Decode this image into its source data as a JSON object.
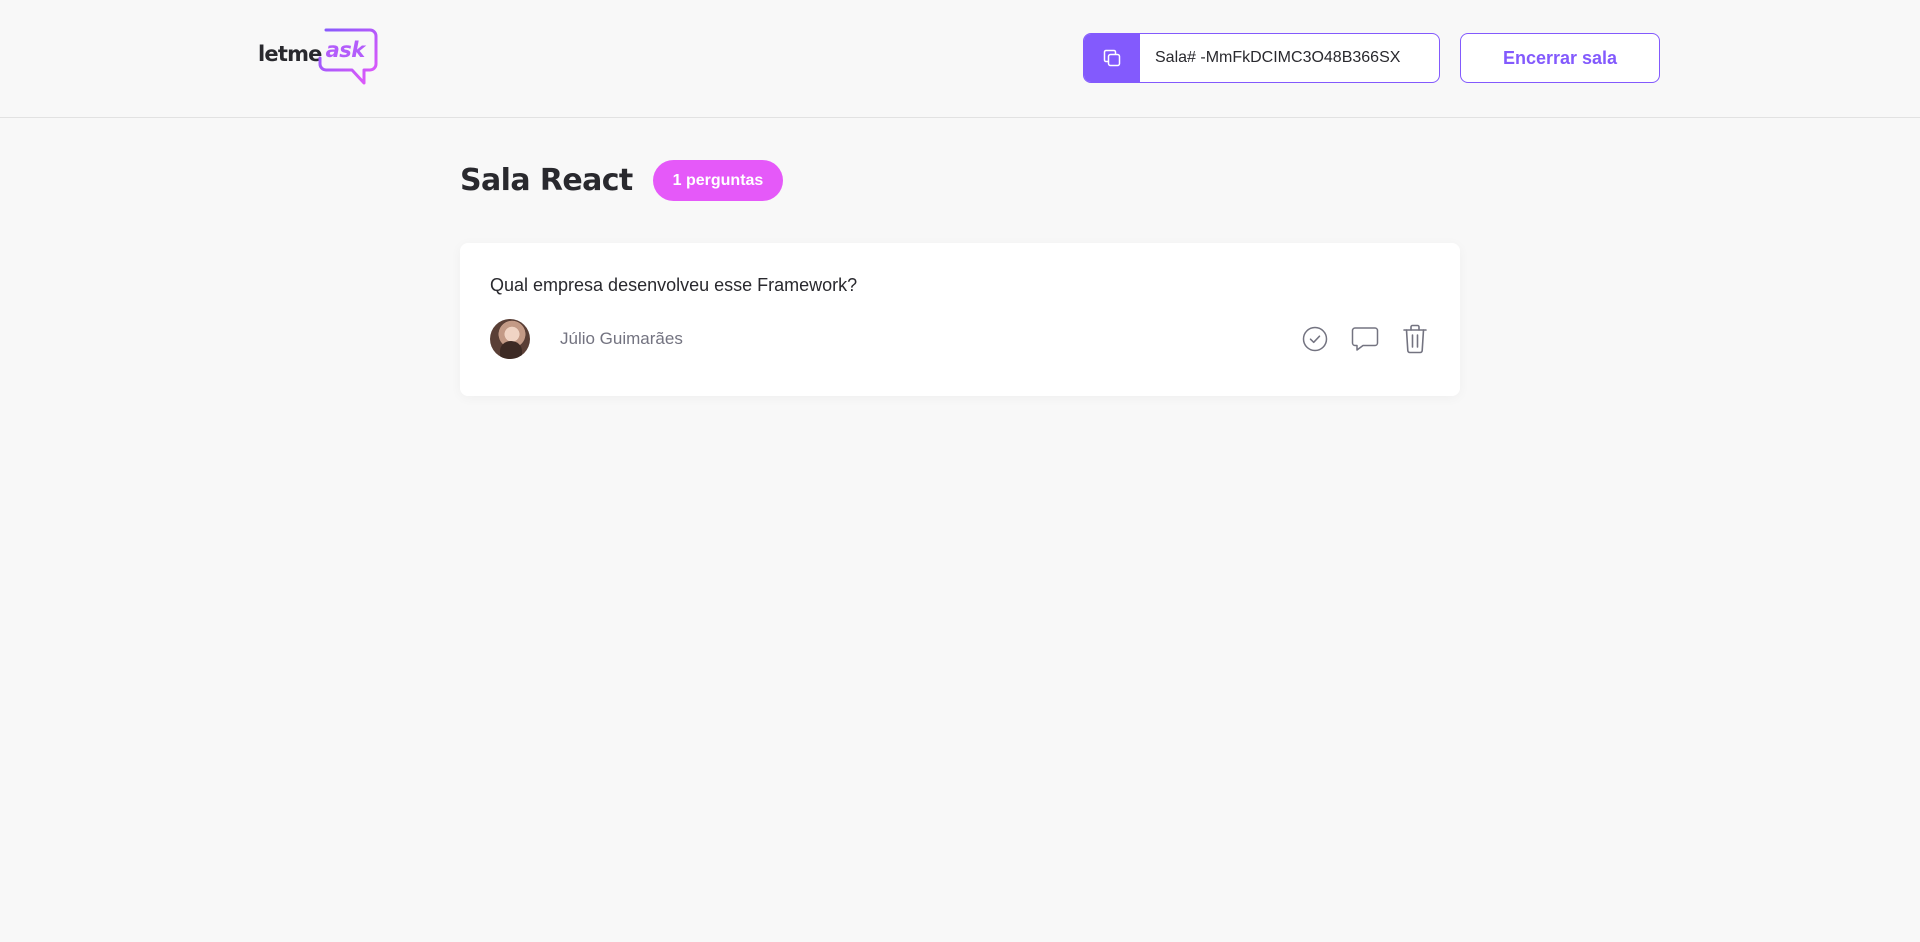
{
  "header": {
    "logo": {
      "text_main": "letme",
      "text_accent": "ask"
    },
    "room_code": {
      "value": "Sala# -MmFkDCIMC3O48B366SX",
      "icon": "copy-icon"
    },
    "close_room_label": "Encerrar sala"
  },
  "room": {
    "title": "Sala React",
    "question_count_label": "1 perguntas"
  },
  "questions": [
    {
      "content": "Qual empresa desenvolveu esse Framework?",
      "author": {
        "name": "Júlio Guimarães",
        "avatar": "avatar"
      },
      "actions": [
        {
          "icon": "check-circle-icon"
        },
        {
          "icon": "chat-bubble-icon"
        },
        {
          "icon": "trash-icon"
        }
      ]
    }
  ],
  "colors": {
    "brand_purple": "#835afd",
    "badge_pink": "#e559f9",
    "background": "#f8f8f8",
    "text_dark": "#29292e",
    "text_muted": "#737380"
  }
}
